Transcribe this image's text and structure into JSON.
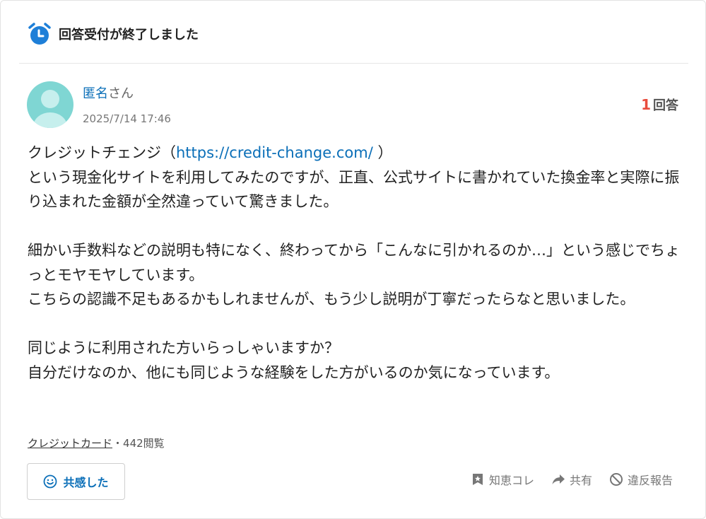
{
  "status": {
    "text": "回答受付が終了しました",
    "icon": "alarm-clock-icon",
    "accent": "#1e7fd8"
  },
  "author": {
    "name": "匿名",
    "suffix": "さん",
    "date": "2025/7/14 17:46",
    "avatar_color": "#7fd6d3"
  },
  "answers": {
    "count": "1",
    "label": "回答"
  },
  "question": {
    "line1_prefix": "クレジットチェンジ（",
    "url": "https://credit-change.com/",
    "line1_suffix": " ）",
    "para1": "という現金化サイトを利用してみたのですが、正直、公式サイトに書かれていた換金率と実際に振り込まれた金額が全然違っていて驚きました。",
    "para2a": "細かい手数料などの説明も特になく、終わってから「こんなに引かれるのか…」という感じでちょっとモヤモヤしています。",
    "para2b": "こちらの認識不足もあるかもしれませんが、もう少し説明が丁寧だったらなと思いました。",
    "para3a": "同じように利用された方いらっしゃいますか？",
    "para3b": "自分だけなのか、他にも同じような経験をした方がいるのか気になっています。"
  },
  "meta": {
    "category": "クレジットカード",
    "separator": "・",
    "views": "442閲覧"
  },
  "buttons": {
    "empathy": "共感した",
    "bookmark": "知恵コレ",
    "share": "共有",
    "report": "違反報告"
  }
}
